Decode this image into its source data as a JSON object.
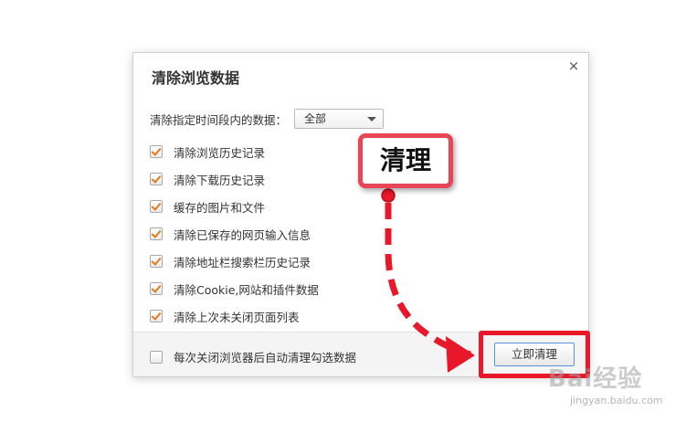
{
  "dialog": {
    "title": "清除浏览数据",
    "close_icon": "×",
    "range_label": "清除指定时间段内的数据：",
    "range_value": "全部",
    "options": [
      {
        "label": "清除浏览历史记录",
        "checked": true
      },
      {
        "label": "清除下载历史记录",
        "checked": true
      },
      {
        "label": "缓存的图片和文件",
        "checked": true
      },
      {
        "label": "清除已保存的网页输入信息",
        "checked": true
      },
      {
        "label": "清除地址栏搜索栏历史记录",
        "checked": true
      },
      {
        "label": "清除Cookie,网站和插件数据",
        "checked": true
      },
      {
        "label": "清除上次未关闭页面列表",
        "checked": true
      }
    ],
    "footer_option": {
      "label": "每次关闭浏览器后自动清理勾选数据",
      "checked": false
    },
    "clear_button": "立即清理"
  },
  "annotation": {
    "label": "清理",
    "color": "#e8172a"
  },
  "watermark": {
    "text": "Bai经验",
    "sub": "jingyan.baidu.com"
  }
}
